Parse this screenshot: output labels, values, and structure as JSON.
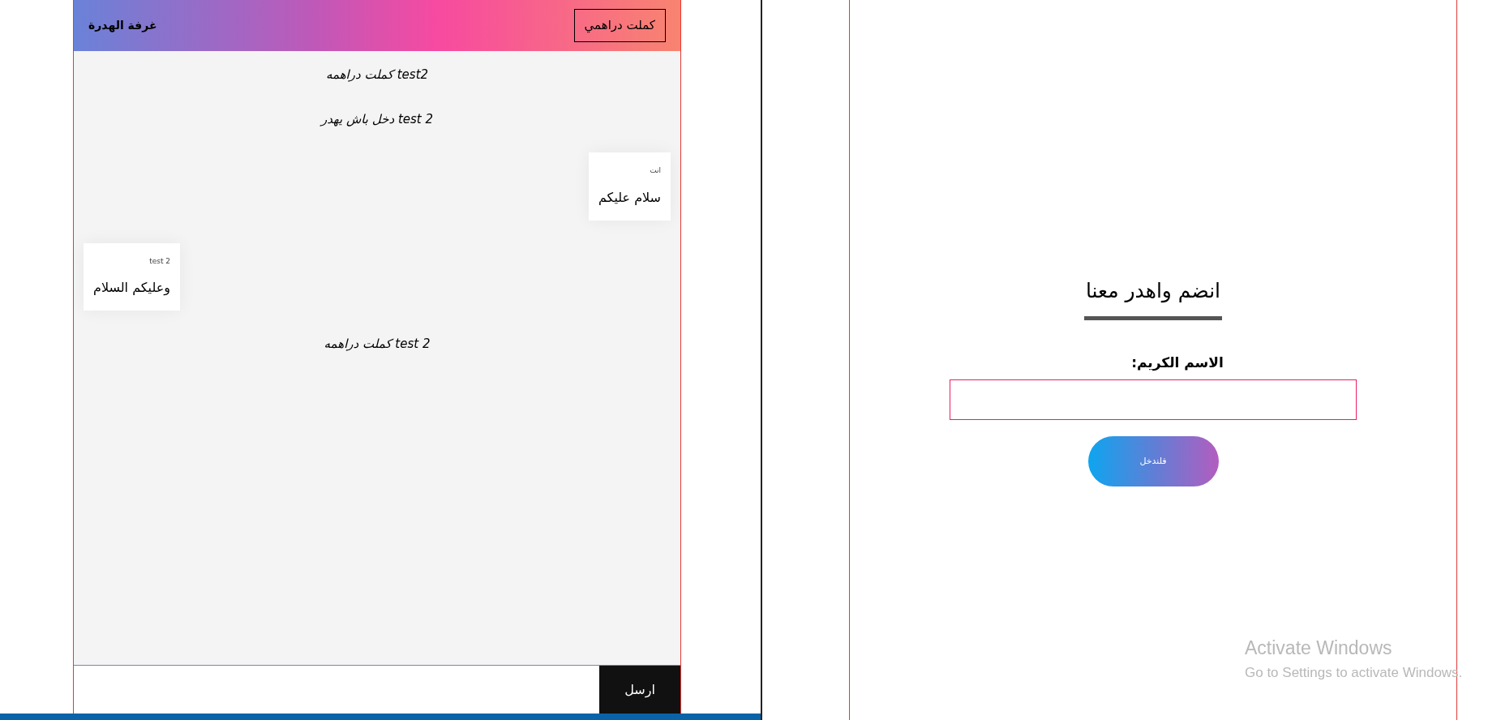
{
  "chat": {
    "title": "غرفة الهدرة",
    "leave_button": "كملت دراهمي",
    "messages": [
      {
        "kind": "notice",
        "text": "كملت دراهمه test2"
      },
      {
        "kind": "notice",
        "text": "دخل باش يهدر test 2"
      },
      {
        "kind": "bubble",
        "mine": true,
        "sender": "انت",
        "text": "سلام عليكم"
      },
      {
        "kind": "bubble",
        "mine": false,
        "sender": "test 2",
        "text": "وعليكم السلام"
      },
      {
        "kind": "notice",
        "text": "كملت دراهمه test 2"
      }
    ],
    "send_button": "ارسل"
  },
  "join": {
    "title": "انضم واهدر معنا",
    "name_label": "الاسم الكريم:",
    "submit_button": "فلندخل"
  },
  "os_notice": {
    "title": "Activate Windows",
    "text": "Go to Settings to activate Windows."
  }
}
